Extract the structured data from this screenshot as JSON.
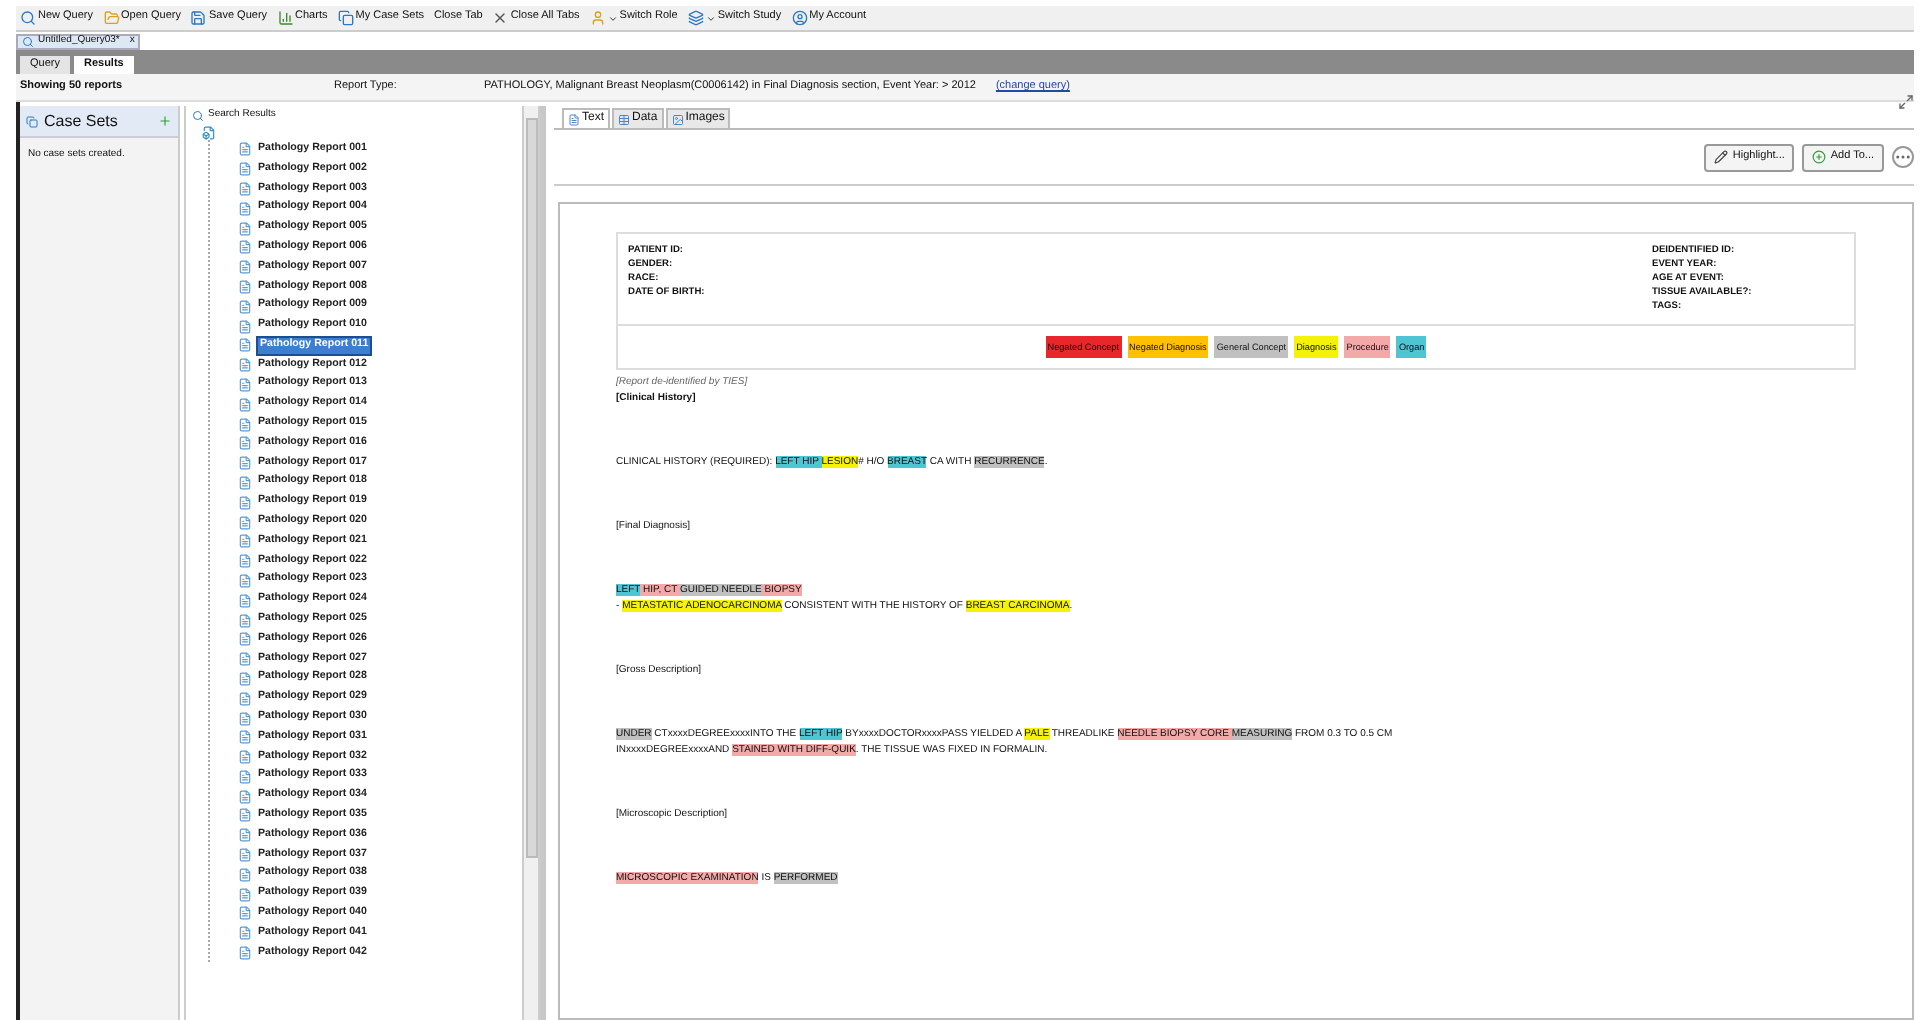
{
  "toolbar": [
    {
      "label": "New Query",
      "kind": "search"
    },
    {
      "label": "Open Query",
      "kind": "open"
    },
    {
      "label": "Save Query",
      "kind": "save"
    },
    {
      "label": "Charts",
      "kind": "chart"
    },
    {
      "label": "My Case Sets",
      "kind": "sets"
    },
    {
      "label": "Close Tab",
      "kind": "none"
    },
    {
      "label": "Close All Tabs",
      "kind": "closeall"
    },
    {
      "label": "Switch Role",
      "kind": "role"
    },
    {
      "label": "Switch Study",
      "kind": "study"
    },
    {
      "label": "My Account",
      "kind": "account"
    }
  ],
  "document_tab": {
    "label": "Untitled_Query03*",
    "close": "x"
  },
  "view_tabs": [
    {
      "label": "Query",
      "selected": false
    },
    {
      "label": "Results",
      "selected": true
    }
  ],
  "summary": {
    "count": "Showing 50 reports",
    "report_type_label": "Report Type:",
    "report_type": "PATHOLOGY, Malignant Breast Neoplasm(C0006142) in Final Diagnosis section, Event Year: > 2012",
    "link": "(change query)"
  },
  "case_sets": {
    "title": "Case Sets",
    "empty": "No case sets created."
  },
  "tree": {
    "title": "Search Results",
    "items": [
      {
        "label": "Pathology Report 001",
        "selected": false
      },
      {
        "label": "Pathology Report 002",
        "selected": false
      },
      {
        "label": "Pathology Report 003",
        "selected": false
      },
      {
        "label": "Pathology Report 004",
        "selected": false
      },
      {
        "label": "Pathology Report 005",
        "selected": false
      },
      {
        "label": "Pathology Report 006",
        "selected": false
      },
      {
        "label": "Pathology Report 007",
        "selected": false
      },
      {
        "label": "Pathology Report 008",
        "selected": false
      },
      {
        "label": "Pathology Report 009",
        "selected": false
      },
      {
        "label": "Pathology Report 010",
        "selected": false
      },
      {
        "label": "Pathology Report 011",
        "selected": true
      },
      {
        "label": "Pathology Report 012",
        "selected": false
      },
      {
        "label": "Pathology Report 013",
        "selected": false
      },
      {
        "label": "Pathology Report 014",
        "selected": false
      },
      {
        "label": "Pathology Report 015",
        "selected": false
      },
      {
        "label": "Pathology Report 016",
        "selected": false
      },
      {
        "label": "Pathology Report 017",
        "selected": false
      },
      {
        "label": "Pathology Report 018",
        "selected": false
      },
      {
        "label": "Pathology Report 019",
        "selected": false
      },
      {
        "label": "Pathology Report 020",
        "selected": false
      },
      {
        "label": "Pathology Report 021",
        "selected": false
      },
      {
        "label": "Pathology Report 022",
        "selected": false
      },
      {
        "label": "Pathology Report 023",
        "selected": false
      },
      {
        "label": "Pathology Report 024",
        "selected": false
      },
      {
        "label": "Pathology Report 025",
        "selected": false
      },
      {
        "label": "Pathology Report 026",
        "selected": false
      },
      {
        "label": "Pathology Report 027",
        "selected": false
      },
      {
        "label": "Pathology Report 028",
        "selected": false
      },
      {
        "label": "Pathology Report 029",
        "selected": false
      },
      {
        "label": "Pathology Report 030",
        "selected": false
      },
      {
        "label": "Pathology Report 031",
        "selected": false
      },
      {
        "label": "Pathology Report 032",
        "selected": false
      },
      {
        "label": "Pathology Report 033",
        "selected": false
      },
      {
        "label": "Pathology Report 034",
        "selected": false
      },
      {
        "label": "Pathology Report 035",
        "selected": false
      },
      {
        "label": "Pathology Report 036",
        "selected": false
      },
      {
        "label": "Pathology Report 037",
        "selected": false
      },
      {
        "label": "Pathology Report 038",
        "selected": false
      },
      {
        "label": "Pathology Report 039",
        "selected": false
      },
      {
        "label": "Pathology Report 040",
        "selected": false
      },
      {
        "label": "Pathology Report 041",
        "selected": false
      },
      {
        "label": "Pathology Report 042",
        "selected": false
      }
    ]
  },
  "report_tabs": [
    {
      "label": "Text",
      "selected": true,
      "kind": "text"
    },
    {
      "label": "Data",
      "selected": false,
      "kind": "data"
    },
    {
      "label": "Images",
      "selected": false,
      "kind": "images"
    }
  ],
  "actions": [
    {
      "label": "Highlight...",
      "kind": "pencil"
    },
    {
      "label": "Add To...",
      "kind": "add"
    }
  ],
  "header_left": [
    "PATIENT ID:",
    "GENDER:",
    "RACE:",
    "DATE OF BIRTH:"
  ],
  "header_right": [
    "DEIDENTIFIED ID:",
    "EVENT YEAR:",
    "AGE AT EVENT:",
    "TISSUE AVAILABLE?:",
    "TAGS:"
  ],
  "legend": [
    {
      "label": "Negated Concept",
      "color": "#e8262b"
    },
    {
      "label": "Negated Diagnosis",
      "color": "#ffc000"
    },
    {
      "label": "General Concept",
      "color": "#c0c0c0"
    },
    {
      "label": "Diagnosis",
      "color": "#f5f20a"
    },
    {
      "label": "Procedure",
      "color": "#f4a9a9"
    },
    {
      "label": "Organ",
      "color": "#4fc4d2"
    }
  ],
  "deid_note": "[Report de-identified by TIES]",
  "sections": [
    {
      "heading": "[Clinical History]",
      "lines": [
        [
          {
            "text": "CLINICAL HISTORY (REQUIRED): ",
            "kind": "plain"
          },
          {
            "text": "LEFT HIP ",
            "kind": "organ"
          },
          {
            "text": "LESION",
            "kind": "diagnosis"
          },
          {
            "text": "# H/O ",
            "kind": "plain"
          },
          {
            "text": "BREAST",
            "kind": "organ"
          },
          {
            "text": " CA WITH ",
            "kind": "plain"
          },
          {
            "text": "RECURRENCE",
            "kind": "general"
          },
          {
            "text": ".",
            "kind": "plain"
          }
        ]
      ]
    },
    {
      "heading": "[Final Diagnosis]",
      "lines": [
        [
          {
            "text": "LEFT",
            "kind": "organ"
          },
          {
            "text": " HIP, CT ",
            "kind": "procedure"
          },
          {
            "text": "GUIDED NEEDLE",
            "kind": "general"
          },
          {
            "text": " BIOPSY",
            "kind": "procedure"
          }
        ],
        [
          {
            "text": "- ",
            "kind": "plain"
          },
          {
            "text": "METASTATIC ADENOCARCINOMA",
            "kind": "diagnosis"
          },
          {
            "text": " CONSISTENT WITH THE HISTORY OF ",
            "kind": "plain"
          },
          {
            "text": "BREAST CARCINOMA",
            "kind": "diagnosis"
          },
          {
            "text": ".",
            "kind": "plain"
          }
        ]
      ]
    },
    {
      "heading": "[Gross Description]",
      "lines": [
        [
          {
            "text": "UNDER",
            "kind": "general"
          },
          {
            "text": " CTxxxxDEGREExxxxINTO THE ",
            "kind": "plain"
          },
          {
            "text": "LEFT HIP",
            "kind": "organ"
          },
          {
            "text": " BYxxxxDOCTORxxxxPASS YIELDED A ",
            "kind": "plain"
          },
          {
            "text": "PALE",
            "kind": "diagnosis"
          },
          {
            "text": " THREADLIKE ",
            "kind": "plain"
          },
          {
            "text": "NEEDLE BIOPSY CORE ",
            "kind": "procedure"
          },
          {
            "text": "MEASURING",
            "kind": "general"
          },
          {
            "text": " FROM 0.3 TO 0.5 CM",
            "kind": "plain"
          }
        ],
        [
          {
            "text": "INxxxxDEGREExxxxAND ",
            "kind": "plain"
          },
          {
            "text": "STAINED WITH DIFF-QUIK",
            "kind": "procedure"
          },
          {
            "text": ". THE TISSUE WAS FIXED IN FORMALIN.",
            "kind": "plain"
          }
        ]
      ]
    },
    {
      "heading": "[Microscopic Description]",
      "lines": [
        [
          {
            "text": "MICROSCOPIC EXAMINATION",
            "kind": "procedure"
          },
          {
            "text": " IS ",
            "kind": "plain"
          },
          {
            "text": "PERFORMED",
            "kind": "general"
          }
        ]
      ]
    }
  ]
}
